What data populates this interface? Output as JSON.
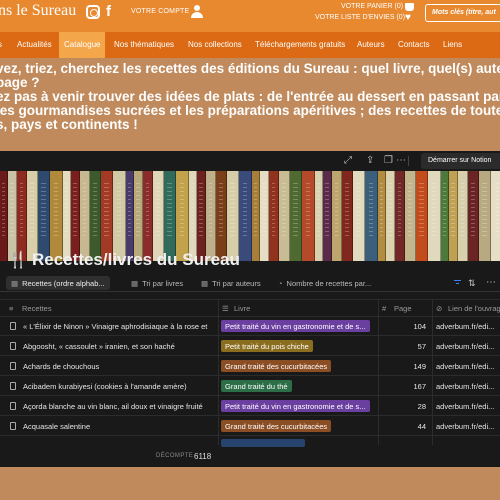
{
  "header": {
    "logo": "ns le Sureau",
    "account_label": "VOTRE COMPTE",
    "cart_label": "VOTRE PANIER (0)",
    "wishlist_label": "VOTRE LISTE D'ENVIES (0)",
    "search_placeholder": "Mots clés (titre, aut",
    "icons": [
      "instagram-icon",
      "facebook-icon",
      "user-icon",
      "cart-icon",
      "heart-icon"
    ],
    "colors": {
      "top": "#e8892f",
      "nav": "#dc6a14",
      "active": "#f4a64a"
    }
  },
  "nav": {
    "items": [
      {
        "label": "s"
      },
      {
        "label": "Actualités"
      },
      {
        "label": "Catalogue",
        "active": true
      },
      {
        "label": "Nos thématiques"
      },
      {
        "label": "Nos collections"
      },
      {
        "label": "Téléchargements gratuits"
      },
      {
        "label": "Auteurs"
      },
      {
        "label": "Contacts"
      },
      {
        "label": "Liens"
      }
    ]
  },
  "intro": {
    "lines": [
      "vez, triez, cherchez les recettes des éditions du Sureau : quel livre, quel(s) auteur",
      "page ?",
      "ez pas à venir trouver des idées de plats : de l'entrée au dessert en passant par",
      "les gourmandises sucrées et les préparations apéritives ; des recettes de toute",
      "s, pays et continents !"
    ]
  },
  "notion": {
    "button_label": "Démarrer sur Notion",
    "toolbar_icons": [
      "expand-icon",
      "share-icon",
      "copy-icon",
      "more-icon"
    ],
    "db_icon": "fork-knife-icon",
    "db_title": "Recettes/livres du Sureau",
    "views": [
      {
        "label": "Recettes (ordre alphab...",
        "icon": "table-icon",
        "active": true
      },
      {
        "label": "Tri par livres",
        "icon": "table-icon"
      },
      {
        "label": "Tri par auteurs",
        "icon": "table-icon"
      },
      {
        "label": "Nombre de recettes par...",
        "icon": "chart-icon"
      }
    ],
    "columns": [
      {
        "label": "Recettes",
        "icon": "text-icon"
      },
      {
        "label": "Livre",
        "icon": "list-icon"
      },
      {
        "label": "Page",
        "icon": "hash-icon"
      },
      {
        "label": "Lien de l'ouvrag",
        "icon": "link-icon"
      }
    ],
    "rows": [
      {
        "title": "« L'Élixir de Ninon » Vinaigre aphrodisiaque à la rose et",
        "book": "Petit traité du vin en gastronomie et de s...",
        "color": "#6b3fa0",
        "page": "104",
        "link": "adverbum.fr/edi..."
      },
      {
        "title": "Abgoosht, « cassoulet » iranien, et son haché",
        "book": "Petit traité du pois chiche",
        "color": "#8a6d1e",
        "page": "57",
        "link": "adverbum.fr/edi..."
      },
      {
        "title": "Achards de chouchous",
        "book": "Grand traité des cucurbitacées",
        "color": "#8a4d24",
        "page": "149",
        "link": "adverbum.fr/edi..."
      },
      {
        "title": "Acibadem kurabiyesi (cookies à l'amande amère)",
        "book": "Grand traité du thé",
        "color": "#2c6e47",
        "page": "167",
        "link": "adverbum.fr/edi..."
      },
      {
        "title": "Açorda blanche au vin blanc, ail doux et vinaigre fruité",
        "book": "Petit traité du vin en gastronomie et de s...",
        "color": "#6b3fa0",
        "page": "28",
        "link": "adverbum.fr/edi..."
      },
      {
        "title": "Acquasale salentine",
        "book": "Grand traité des cucurbitacées",
        "color": "#8a4d24",
        "page": "44",
        "link": "adverbum.fr/edi..."
      }
    ],
    "count_label": "DÉCOMPTE",
    "count_value": "6118"
  }
}
